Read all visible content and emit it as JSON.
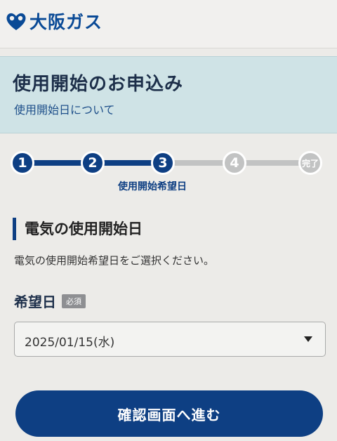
{
  "brand": {
    "name": "大阪ガス",
    "logo_icon": "flame-heart-icon",
    "color": "#0a4a96"
  },
  "title": {
    "main": "使用開始のお申込み",
    "sub": "使用開始日について"
  },
  "stepper": {
    "steps": [
      {
        "label": "1",
        "state": "done"
      },
      {
        "label": "2",
        "state": "done"
      },
      {
        "label": "3",
        "state": "current"
      },
      {
        "label": "4",
        "state": "todo"
      },
      {
        "label": "完了",
        "state": "todo"
      }
    ],
    "current_caption": "使用開始希望日",
    "active_color": "#0e3f83",
    "inactive_color": "#c2c3c3"
  },
  "section": {
    "title": "電気の使用開始日",
    "instructions": "電気の使用開始希望日をご選択ください。"
  },
  "field": {
    "label": "希望日",
    "required_badge": "必須",
    "selected_value": "2025/01/15(水)"
  },
  "actions": {
    "next_label": "確認画面へ進む"
  }
}
